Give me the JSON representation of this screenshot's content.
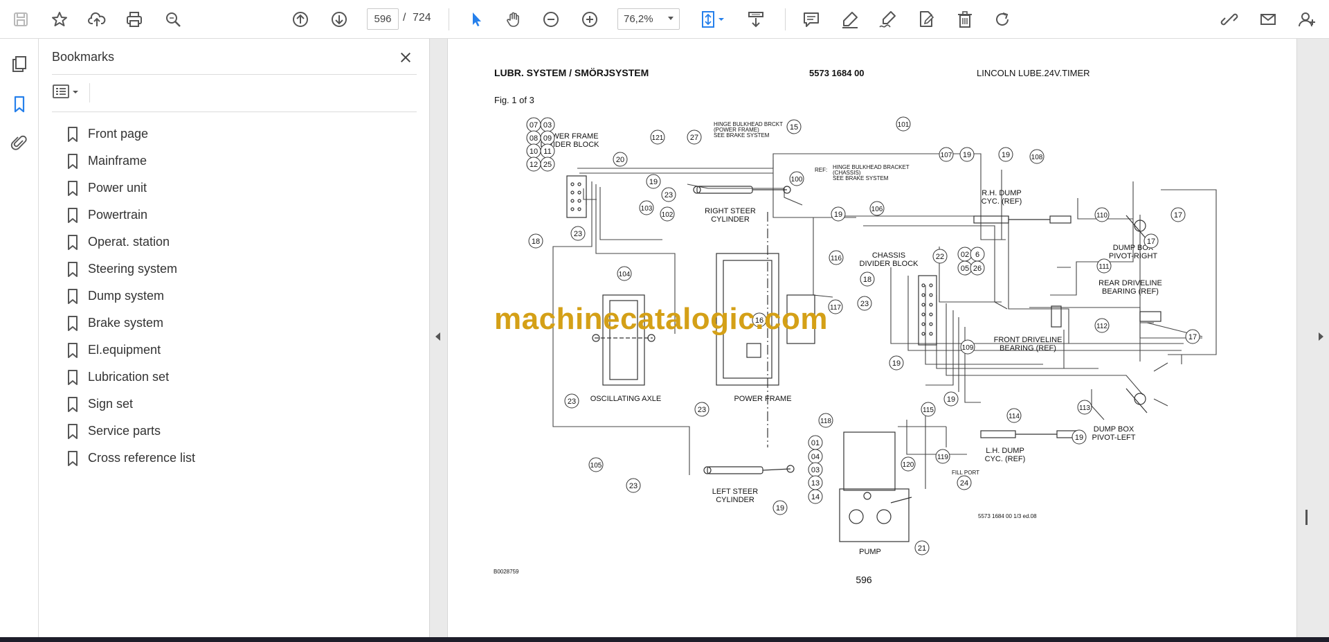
{
  "toolbar": {
    "page_current": "596",
    "page_separator": "/",
    "page_total": "724",
    "zoom": "76,2%"
  },
  "bookmarks": {
    "title": "Bookmarks",
    "items": [
      {
        "label": "Front page"
      },
      {
        "label": "Mainframe"
      },
      {
        "label": "Power unit"
      },
      {
        "label": "Powertrain"
      },
      {
        "label": "Operat. station"
      },
      {
        "label": "Steering system"
      },
      {
        "label": "Dump system"
      },
      {
        "label": "Brake system"
      },
      {
        "label": "El.equipment"
      },
      {
        "label": "Lubrication set"
      },
      {
        "label": "Sign set"
      },
      {
        "label": "Service parts"
      },
      {
        "label": "Cross reference list"
      }
    ]
  },
  "document": {
    "header_title": "LUBR. SYSTEM / SMÖRJSYSTEM",
    "header_number": "5573 1684 00",
    "header_desc": "LINCOLN LUBE.24V.TIMER",
    "fig": "Fig. 1 of 3",
    "labels": {
      "power_frame_divider": [
        "POWER FRAME",
        "DIVIDER BLOCK"
      ],
      "hinge_power": [
        "HINGE BULKHEAD BRCKT",
        "(POWER FRAME)",
        "SEE BRAKE SYSTEM"
      ],
      "hinge_chassis_ref": "REF:",
      "hinge_chassis": [
        "HINGE BULKHEAD BRACKET",
        "(CHASSIS)",
        "SEE BRAKE SYSTEM"
      ],
      "rh_dump": [
        "R.H. DUMP",
        "CYC. (REF)"
      ],
      "dump_box_right": [
        "DUMP BOX",
        "PIVOT-RIGHT"
      ],
      "right_steer": [
        "RIGHT STEER",
        "CYLINDER"
      ],
      "chassis_divider": [
        "CHASSIS",
        "DIVIDER BLOCK"
      ],
      "rear_driveline": [
        "REAR DRIVELINE",
        "BEARING (REF)"
      ],
      "front_driveline": [
        "FRONT DRIVELINE",
        "BEARING (REF)"
      ],
      "oscillating_axle": "OSCILLATING AXLE",
      "power_frame": "POWER FRAME",
      "lh_dump": [
        "L.H. DUMP",
        "CYC. (REF)"
      ],
      "dump_box_left": [
        "DUMP BOX",
        "PIVOT-LEFT"
      ],
      "left_steer": [
        "LEFT STEER",
        "CYLINDER"
      ],
      "fill_port": "FILL PORT",
      "pump": "PUMP",
      "edition": "5573 1684 00 1/3 ed.08",
      "drawing_no": "B0028759",
      "page_no": "596"
    },
    "callouts": [
      {
        "n": "07"
      },
      {
        "n": "03"
      },
      {
        "n": "08"
      },
      {
        "n": "09"
      },
      {
        "n": "10"
      },
      {
        "n": "11"
      },
      {
        "n": "12"
      },
      {
        "n": "25"
      },
      {
        "n": "20"
      },
      {
        "n": "121"
      },
      {
        "n": "27"
      },
      {
        "n": "15"
      },
      {
        "n": "101"
      },
      {
        "n": "107"
      },
      {
        "n": "19"
      },
      {
        "n": "19"
      },
      {
        "n": "108"
      },
      {
        "n": "100"
      },
      {
        "n": "19"
      },
      {
        "n": "23"
      },
      {
        "n": "103"
      },
      {
        "n": "102"
      },
      {
        "n": "19"
      },
      {
        "n": "106"
      },
      {
        "n": "110"
      },
      {
        "n": "17"
      },
      {
        "n": "17"
      },
      {
        "n": "18"
      },
      {
        "n": "23"
      },
      {
        "n": "104"
      },
      {
        "n": "116"
      },
      {
        "n": "22"
      },
      {
        "n": "02"
      },
      {
        "n": "6"
      },
      {
        "n": "05"
      },
      {
        "n": "26"
      },
      {
        "n": "18"
      },
      {
        "n": "111"
      },
      {
        "n": "23"
      },
      {
        "n": "117"
      },
      {
        "n": "16"
      },
      {
        "n": "112"
      },
      {
        "n": "109"
      },
      {
        "n": "17"
      },
      {
        "n": "19"
      },
      {
        "n": "23"
      },
      {
        "n": "23"
      },
      {
        "n": "19"
      },
      {
        "n": "115"
      },
      {
        "n": "114"
      },
      {
        "n": "113"
      },
      {
        "n": "118"
      },
      {
        "n": "19"
      },
      {
        "n": "01"
      },
      {
        "n": "04"
      },
      {
        "n": "120"
      },
      {
        "n": "119"
      },
      {
        "n": "105"
      },
      {
        "n": "03"
      },
      {
        "n": "13"
      },
      {
        "n": "24"
      },
      {
        "n": "23"
      },
      {
        "n": "14"
      },
      {
        "n": "19"
      },
      {
        "n": "21"
      }
    ]
  },
  "watermark": "machinecatalogic.com"
}
